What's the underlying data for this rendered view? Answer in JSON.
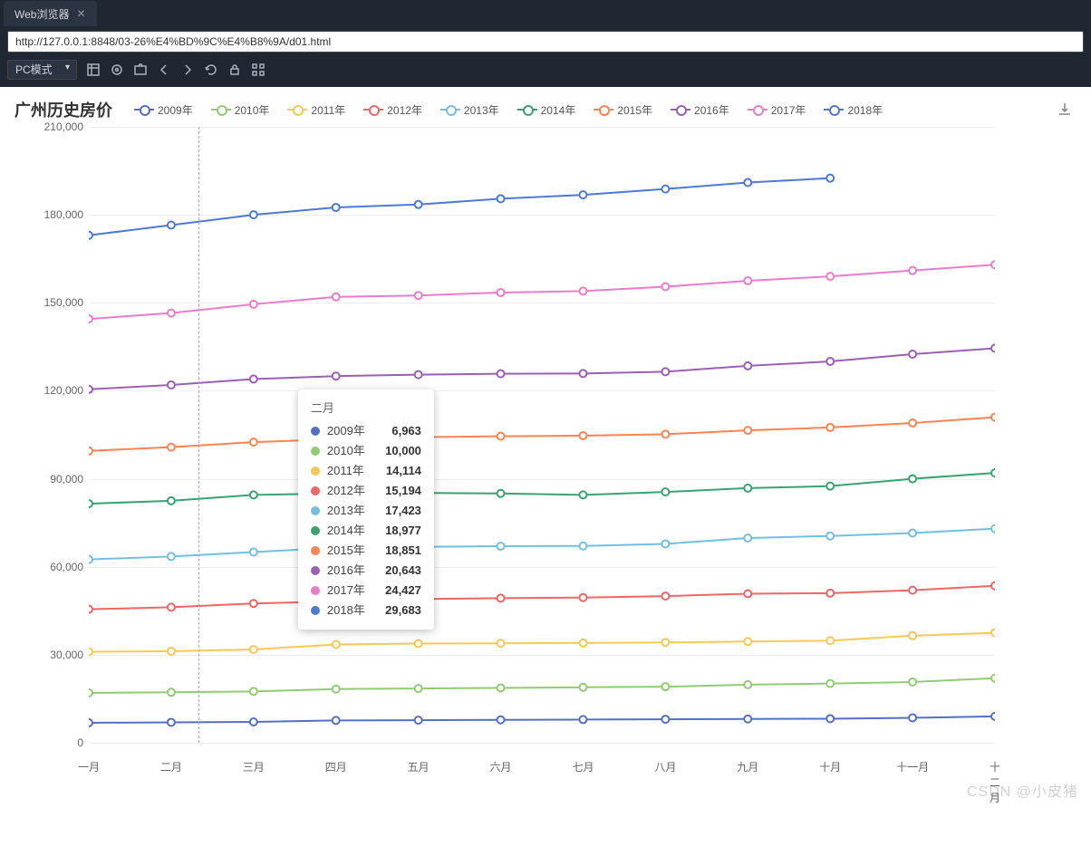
{
  "browser": {
    "tab_title": "Web浏览器",
    "url": "http://127.0.0.1:8848/03-26%E4%BD%9C%E4%B8%9A/d01.html",
    "mode": "PC模式"
  },
  "watermark": "CSDN @小皮猪",
  "chart_data": {
    "type": "line",
    "title": "广州历史房价",
    "xlabel": "",
    "ylabel": "",
    "ylim": [
      0,
      210000
    ],
    "y_ticks": [
      0,
      30000,
      60000,
      90000,
      120000,
      150000,
      180000,
      210000
    ],
    "y_tick_labels": [
      "0",
      "30,000",
      "60,000",
      "90,000",
      "120,000",
      "150,000",
      "180,000",
      "210,000"
    ],
    "categories": [
      "一月",
      "二月",
      "三月",
      "四月",
      "五月",
      "六月",
      "七月",
      "八月",
      "九月",
      "十月",
      "十一月",
      "十二月"
    ],
    "series": [
      {
        "name": "2009年",
        "color": "#5470c6",
        "values": [
          6800,
          6963,
          7100,
          7600,
          7700,
          7800,
          7900,
          8000,
          8100,
          8200,
          8500,
          9000
        ]
      },
      {
        "name": "2010年",
        "color": "#91cc75",
        "values": [
          17000,
          17200,
          17500,
          18300,
          18500,
          18700,
          18900,
          19100,
          19800,
          20200,
          20700,
          22000
        ]
      },
      {
        "name": "2011年",
        "color": "#fac858",
        "values": [
          31000,
          31200,
          31800,
          33500,
          33800,
          33900,
          34000,
          34200,
          34500,
          34800,
          36500,
          37500
        ]
      },
      {
        "name": "2012年",
        "color": "#ee6666",
        "values": [
          45500,
          46200,
          47500,
          48200,
          49000,
          49300,
          49500,
          50000,
          50800,
          51000,
          52000,
          53500
        ]
      },
      {
        "name": "2013年",
        "color": "#73c0de",
        "values": [
          62500,
          63500,
          65000,
          66500,
          66800,
          67000,
          67100,
          67800,
          69800,
          70500,
          71500,
          73000
        ]
      },
      {
        "name": "2014年",
        "color": "#3ba272",
        "values": [
          81500,
          82500,
          84500,
          85000,
          85200,
          85000,
          84500,
          85500,
          86800,
          87500,
          90000,
          92000
        ]
      },
      {
        "name": "2015年",
        "color": "#fc8452",
        "values": [
          99500,
          100800,
          102500,
          103500,
          104200,
          104500,
          104700,
          105200,
          106500,
          107500,
          109000,
          111000
        ]
      },
      {
        "name": "2016年",
        "color": "#9a60b4",
        "values": [
          120500,
          122000,
          124000,
          125000,
          125500,
          125800,
          125900,
          126500,
          128500,
          130000,
          132500,
          134500
        ]
      },
      {
        "name": "2017年",
        "color": "#ea7ccc",
        "values": [
          144500,
          146500,
          149500,
          152000,
          152500,
          153500,
          154000,
          155500,
          157500,
          159000,
          161000,
          163000
        ]
      },
      {
        "name": "2018年",
        "color": "#4e79d6",
        "values": [
          173000,
          176500,
          180000,
          182500,
          183500,
          185500,
          186800,
          188800,
          191000,
          192500,
          null,
          null
        ]
      }
    ],
    "tooltip": {
      "category_index": 1,
      "category_label": "二月",
      "rows": [
        {
          "name": "2009年",
          "color": "#5470c6",
          "value_label": "6,963"
        },
        {
          "name": "2010年",
          "color": "#91cc75",
          "value_label": "10,000"
        },
        {
          "name": "2011年",
          "color": "#fac858",
          "value_label": "14,114"
        },
        {
          "name": "2012年",
          "color": "#ee6666",
          "value_label": "15,194"
        },
        {
          "name": "2013年",
          "color": "#73c0de",
          "value_label": "17,423"
        },
        {
          "name": "2014年",
          "color": "#3ba272",
          "value_label": "18,977"
        },
        {
          "name": "2015年",
          "color": "#fc8452",
          "value_label": "18,851"
        },
        {
          "name": "2016年",
          "color": "#9a60b4",
          "value_label": "20,643"
        },
        {
          "name": "2017年",
          "color": "#ea7ccc",
          "value_label": "24,427"
        },
        {
          "name": "2018年",
          "color": "#4e79d6",
          "value_label": "29,683"
        }
      ]
    }
  }
}
